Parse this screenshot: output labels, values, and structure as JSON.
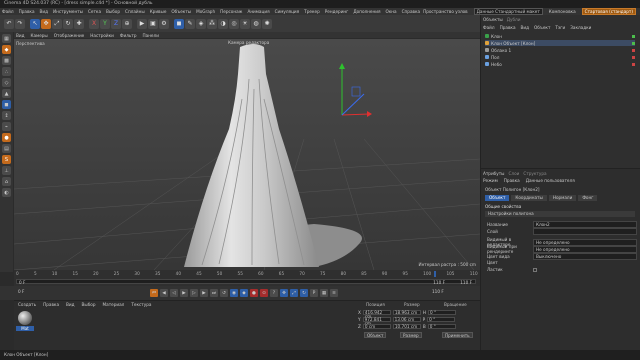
{
  "window": {
    "title": "Cinema 4D S24.037 (RC) - [dress simple.c4d *] - Основной дубль"
  },
  "menubar": [
    "Файл",
    "Правка",
    "Вид",
    "Инструменты",
    "Сетка",
    "Выбор",
    "Сплайны",
    "Кривые",
    "Объекты",
    "MoGraph",
    "Персонаж",
    "Анимация",
    "Симуляция",
    "Трекер",
    "Рендеринг",
    "Дополнения",
    "Окна",
    "Справка"
  ],
  "layout": {
    "label": "Пространство узлов",
    "value1": "Данные Стандартный макет",
    "label2": "Компоновка",
    "value2": "Стартовая (стандарт)"
  },
  "viewport": {
    "menu": [
      "Вид",
      "Камеры",
      "Отображение",
      "Настройки",
      "Фильтр",
      "Панели"
    ],
    "name": "Перспектива",
    "camera_label": "Камера редактора",
    "grid_spacing": "Интервал растра : 500 cm"
  },
  "timeline": {
    "ticks": [
      "0",
      "5",
      "10",
      "15",
      "20",
      "25",
      "30",
      "35",
      "40",
      "45",
      "50",
      "55",
      "60",
      "65",
      "70",
      "75",
      "80",
      "85",
      "90",
      "95",
      "100",
      "105",
      "110"
    ],
    "start": "0 F",
    "current": "0 F",
    "end": "110 F",
    "end2": "110 F",
    "frame_field": "110 F"
  },
  "materials": {
    "menu": [
      "Создать",
      "Правка",
      "Вид",
      "Выбор",
      "Материал",
      "Текстура"
    ],
    "item": "Mat"
  },
  "coords": {
    "headers": [
      "Позиция",
      "Размер",
      "Вращение"
    ],
    "rows": [
      {
        "axis": "X",
        "pos": "416.942 cm",
        "size": "18.963 cm",
        "rot_label": "H",
        "rot": "0 °"
      },
      {
        "axis": "Y",
        "pos": "972.841 cm",
        "size": "13.06 cm",
        "rot_label": "P",
        "rot": "0 °"
      },
      {
        "axis": "Z",
        "pos": "0 cm",
        "size": "10.701 cm",
        "rot_label": "B",
        "rot": "0 °"
      }
    ],
    "mode1": "Объект",
    "mode2": "Размер",
    "apply": "Применить"
  },
  "status": "Клон Объект [Клон]",
  "objects": {
    "tabs": [
      "Объекты",
      "Дубли"
    ],
    "menu": [
      "Файл",
      "Правка",
      "Вид",
      "Объект",
      "Тэги",
      "Закладки"
    ],
    "rows": [
      "Клон",
      "Клон Объект [Клон]",
      "Облако 1",
      "Пол",
      "Небо"
    ]
  },
  "attributes": {
    "tabs": [
      "Атрибуты",
      "Слои",
      "Структура"
    ],
    "menu": [
      "Режим",
      "Правка",
      "Данные пользователя"
    ],
    "object": "Объект Полигон [Клон2]",
    "subtabs": [
      "Объект",
      "Координаты",
      "Нормали",
      "Фонг"
    ],
    "section": "Общие свойства",
    "section2": "Настройки полигона",
    "rows": [
      {
        "label": "Название",
        "value": "Клон2"
      },
      {
        "label": "Слой",
        "value": ""
      },
      {
        "label": "Видимый в редакторе",
        "value": "Не определено"
      },
      {
        "label": "Видимый при рендеринге",
        "value": "Не определено"
      },
      {
        "label": "Цвет вида",
        "value": "Выключено"
      },
      {
        "label": "Цвет",
        "value": ""
      },
      {
        "label": "Ластик",
        "value": ""
      }
    ]
  },
  "colors": {
    "accent": "#2f5fa8",
    "orange": "#c46a1c",
    "axis_x": "#d33",
    "axis_y": "#3c3",
    "axis_z": "#36f"
  }
}
